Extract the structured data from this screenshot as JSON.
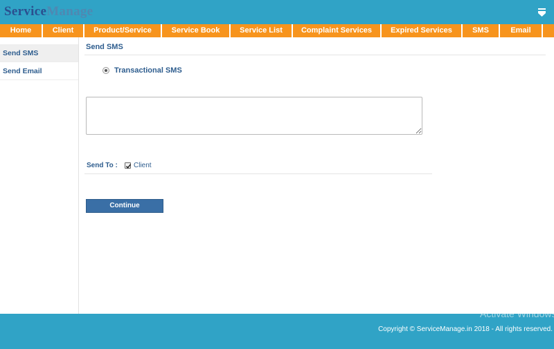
{
  "header": {
    "logo_part1": "Service",
    "logo_part2": "Manage",
    "menu_icon": "download-arrow-icon"
  },
  "nav": {
    "items": [
      {
        "label": "Home"
      },
      {
        "label": "Client"
      },
      {
        "label": "Product/Service"
      },
      {
        "label": "Service Book"
      },
      {
        "label": "Service List"
      },
      {
        "label": "Complaint Services"
      },
      {
        "label": "Expired Services"
      },
      {
        "label": "SMS"
      },
      {
        "label": "Email"
      }
    ]
  },
  "sidebar": {
    "items": [
      {
        "label": "Send SMS",
        "active": true
      },
      {
        "label": "Send Email",
        "active": false
      }
    ]
  },
  "main": {
    "title": "Send SMS",
    "sms_type_label": "Transactional SMS",
    "message_value": "",
    "send_to_label": "Send To :",
    "send_to_option": "Client",
    "send_to_checked": true,
    "continue_label": "Continue"
  },
  "footer": {
    "copyright": "Copyright © ServiceManage.in 2018 - All rights reserved."
  },
  "watermark": {
    "text": "Activate Windows"
  },
  "colors": {
    "header_bg": "#30a3c6",
    "nav_bg": "#f7941d",
    "link_text": "#2e5d8e",
    "button_bg": "#3a6fa6"
  }
}
